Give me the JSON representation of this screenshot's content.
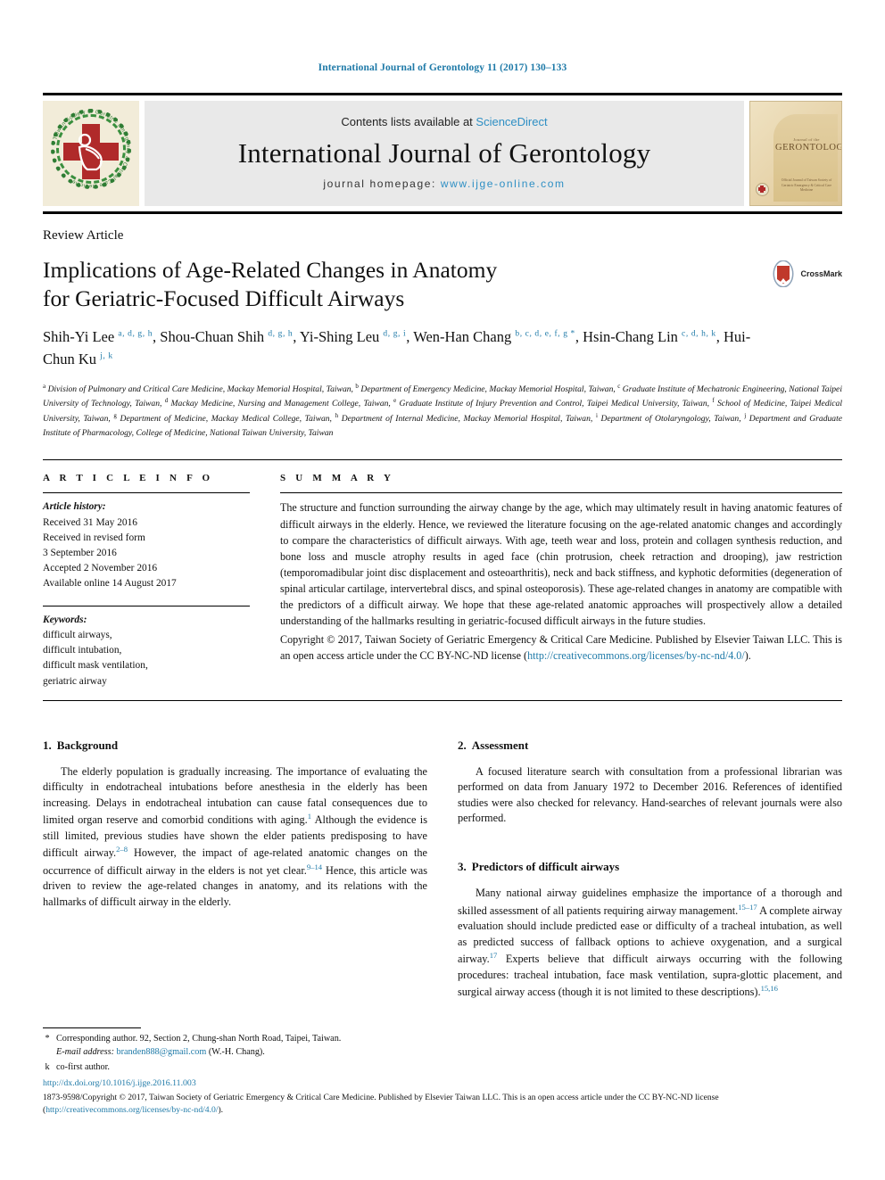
{
  "running_head": "International Journal of Gerontology 11 (2017) 130–133",
  "masthead": {
    "contents_prefix": "Contents lists available at ",
    "contents_link": "ScienceDirect",
    "journal_name": "International Journal of Gerontology",
    "homepage_prefix": "journal homepage: ",
    "homepage_url": "www.ijge-online.com",
    "society_logo_alt": "taiwan-society-of-geriatric-emergency-and-critical-care-medicine-logo",
    "society_ring_text": "Taiwan Society of Geriatric Emergency & Critical Care Medicine",
    "cover": {
      "sub": "Journal of the",
      "title": "GERONTOLOGY",
      "lines": "Official Journal of\nTaiwan Society of Geriatric Emergency\n& Critical Care Medicine"
    }
  },
  "article": {
    "type": "Review Article",
    "title_line1": "Implications of Age-Related Changes in Anatomy",
    "title_line2": "for Geriatric-Focused Difficult Airways",
    "crossmark_label": "CrossMark",
    "authors": [
      {
        "name": "Shih-Yi Lee",
        "sup": "a, d, g, h",
        "sep": ", "
      },
      {
        "name": "Shou-Chuan Shih",
        "sup": "d, g, h",
        "sep": ", "
      },
      {
        "name": "Yi-Shing Leu",
        "sup": "d, g, i",
        "sep": ", "
      },
      {
        "name": "Wen-Han Chang",
        "sup": "b, c, d, e, f, g *",
        "sep": ", "
      },
      {
        "name": "Hsin-Chang Lin",
        "sup": "c, d, h, k",
        "sep": ", "
      },
      {
        "name": "Hui-Chun Ku",
        "sup": "j, k",
        "sep": ""
      }
    ],
    "affiliations": [
      {
        "mark": "a",
        "text": "Division of Pulmonary and Critical Care Medicine, Mackay Memorial Hospital, Taiwan, "
      },
      {
        "mark": "b",
        "text": "Department of Emergency Medicine, Mackay Memorial Hospital, Taiwan, "
      },
      {
        "mark": "c",
        "text": "Graduate Institute of Mechatronic Engineering, National Taipei University of Technology, Taiwan, "
      },
      {
        "mark": "d",
        "text": "Mackay Medicine, Nursing and Management College, Taiwan, "
      },
      {
        "mark": "e",
        "text": "Graduate Institute of Injury Prevention and Control, Taipei Medical University, Taiwan, "
      },
      {
        "mark": "f",
        "text": "School of Medicine, Taipei Medical University, Taiwan, "
      },
      {
        "mark": "g",
        "text": "Department of Medicine, Mackay Medical College, Taiwan, "
      },
      {
        "mark": "h",
        "text": "Department of Internal Medicine, Mackay Memorial Hospital, Taiwan, "
      },
      {
        "mark": "i",
        "text": "Department of Otolaryngology, Taiwan, "
      },
      {
        "mark": "j",
        "text": "Department and Graduate Institute of Pharmacology, College of Medicine, National Taiwan University, Taiwan"
      }
    ]
  },
  "article_info": {
    "heading": "A R T I C L E   I N F O",
    "history_label": "Article history:",
    "history": [
      "Received 31 May 2016",
      "Received in revised form",
      "3 September 2016",
      "Accepted 2 November 2016",
      "Available online 14 August 2017"
    ],
    "keywords_label": "Keywords:",
    "keywords": [
      "difficult airways,",
      "difficult intubation,",
      "difficult mask ventilation,",
      "geriatric airway"
    ]
  },
  "summary": {
    "heading": "S U M M A R Y",
    "text": "The structure and function surrounding the airway change by the age, which may ultimately result in having anatomic features of difficult airways in the elderly. Hence, we reviewed the literature focusing on the age-related anatomic changes and accordingly to compare the characteristics of difficult airways. With age, teeth wear and loss, protein and collagen synthesis reduction, and bone loss and muscle atrophy results in aged face (chin protrusion, cheek retraction and drooping), jaw restriction (temporomadibular joint disc displacement and osteoarthritis), neck and back stiffness, and kyphotic deformities (degeneration of spinal articular cartilage, intervertebral discs, and spinal osteoporosis). These age-related changes in anatomy are compatible with the predictors of a difficult airway. We hope that these age-related anatomic approaches will prospectively allow a detailed understanding of the hallmarks resulting in geriatric-focused difficult airways in the future studies.",
    "copyright_text": "Copyright © 2017, Taiwan Society of Geriatric Emergency & Critical Care Medicine. Published by Elsevier Taiwan LLC. This is an open access article under the CC BY-NC-ND license (",
    "copyright_link": "http://creativecommons.org/licenses/by-nc-nd/4.0/",
    "copyright_tail": ")."
  },
  "sections": [
    {
      "num": "1.",
      "title": "Background",
      "paragraphs": [
        {
          "parts": [
            {
              "t": "The elderly population is gradually increasing. The importance of evaluating the difficulty in endotracheal intubations before anesthesia in the elderly has been increasing. Delays in endotracheal intubation can cause fatal consequences due to limited organ reserve and comorbid conditions with aging."
            },
            {
              "ref": "1"
            },
            {
              "t": " Although the evidence is still limited, previous studies have shown the elder patients predisposing to have difficult airway."
            },
            {
              "ref": "2–8"
            },
            {
              "t": " However, the impact of age-related anatomic changes on the occurrence of difficult airway in the elders is not yet clear."
            },
            {
              "ref": "9–14"
            },
            {
              "t": " Hence, this article was driven to review the age-related changes in anatomy, and its relations with the hallmarks of difficult airway in the elderly."
            }
          ]
        }
      ]
    },
    {
      "num": "2.",
      "title": "Assessment",
      "paragraphs": [
        {
          "parts": [
            {
              "t": "A focused literature search with consultation from a professional librarian was performed on data from January 1972 to December 2016. References of identified studies were also checked for relevancy. Hand-searches of relevant journals were also performed."
            }
          ]
        }
      ]
    },
    {
      "num": "3.",
      "title": "Predictors of difficult airways",
      "paragraphs": [
        {
          "parts": [
            {
              "t": "Many national airway guidelines emphasize the importance of a thorough and skilled assessment of all patients requiring airway management."
            },
            {
              "ref": "15–17"
            },
            {
              "t": " A complete airway evaluation should include predicted ease or difficulty of a tracheal intubation, as well as predicted success of fallback options to achieve oxygenation, and a surgical airway."
            },
            {
              "ref": "17"
            },
            {
              "t": " Experts believe that difficult airways occurring with the following procedures: tracheal intubation, face mask ventilation, supra-glottic placement, and surgical airway access (though it is not limited to these descriptions)."
            },
            {
              "ref": "15,16"
            }
          ]
        }
      ]
    }
  ],
  "footnotes": [
    {
      "mark": "*",
      "prefix": "Corresponding author. 92, Section 2, Chung-shan North Road, Taipei, Taiwan.",
      "email_label": "E-mail address:",
      "email": "branden888@gmail.com",
      "email_tail": " (W.-H. Chang)."
    },
    {
      "mark": "k",
      "prefix": "co-first author.",
      "email_label": "",
      "email": "",
      "email_tail": ""
    }
  ],
  "page_footer": {
    "doi": "http://dx.doi.org/10.1016/j.ijge.2016.11.003",
    "issn_copyright": "1873-9598/Copyright © 2017, Taiwan Society of Geriatric Emergency & Critical Care Medicine. Published by Elsevier Taiwan LLC. This is an open access article under the CC BY-NC-ND license (",
    "license_link": "http://creativecommons.org/licenses/by-nc-nd/4.0/",
    "license_tail": ")."
  },
  "colors": {
    "link_blue": "#1f7aa8",
    "sciencedirect_blue": "#2e8fc4",
    "masthead_grey": "#e9e9e9",
    "logo_red": "#b02a2a",
    "logo_green": "#2f7d34",
    "cover_tan": "#e6d2a8"
  }
}
